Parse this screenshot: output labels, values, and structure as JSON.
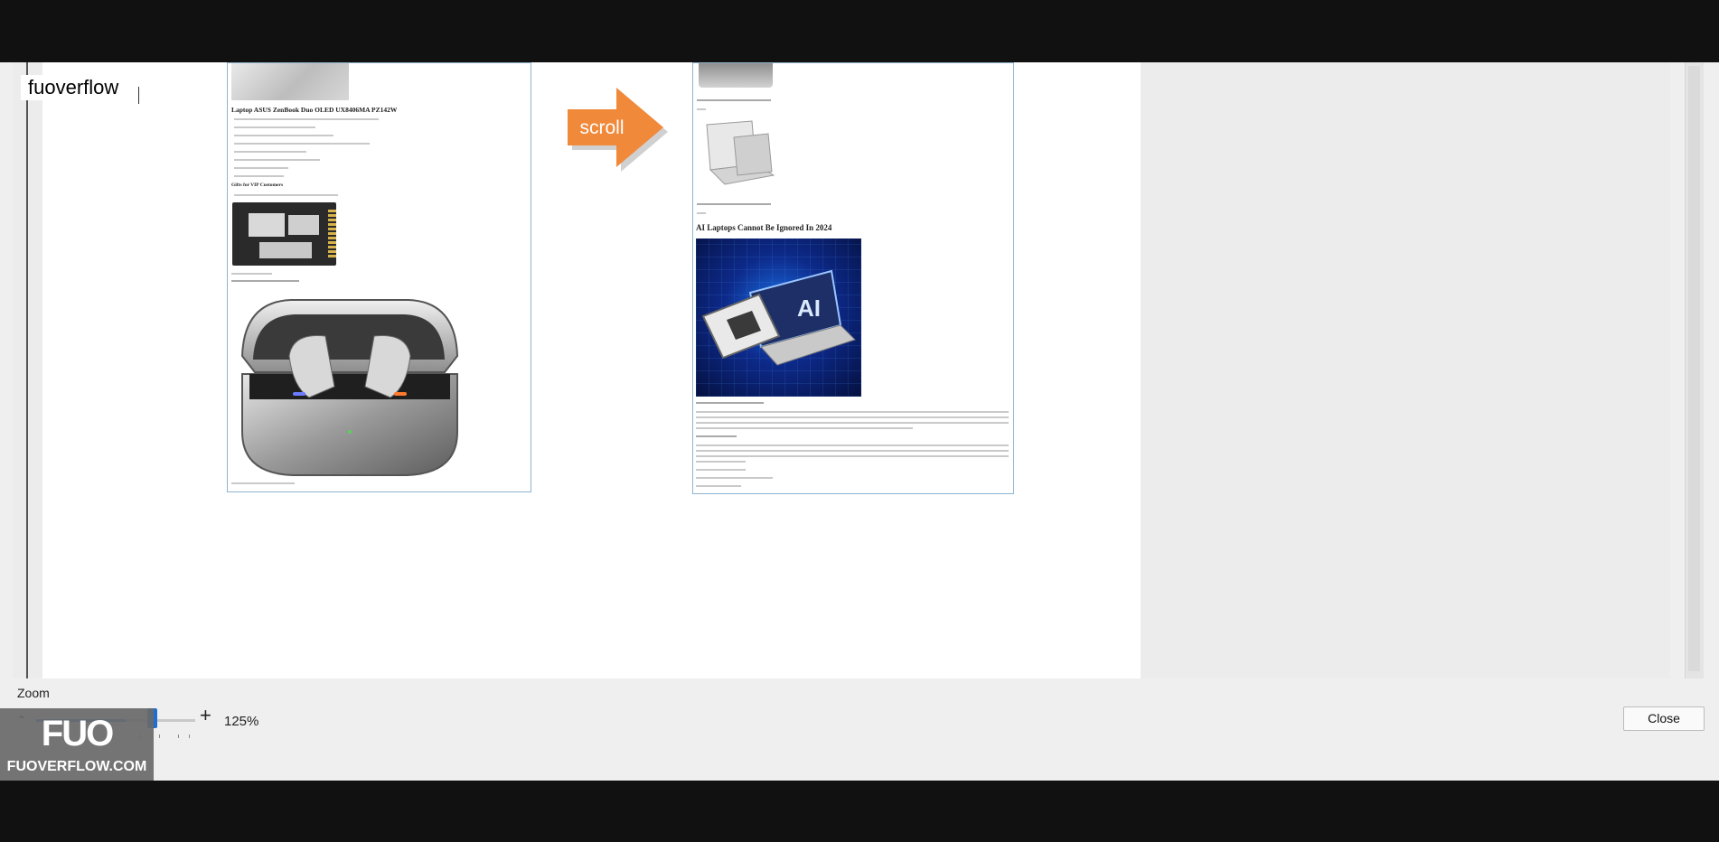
{
  "overlay": {
    "brand_label": "fuoverflow",
    "watermark_logo": "FUO",
    "watermark_text": "FUOVERFLOW.COM"
  },
  "preview": {
    "left_page": {
      "heading": "Laptop ASUS ZenBook Duo OLED UX8406MA PZ142W",
      "gift_heading": "Gifts for VIP Customers"
    },
    "right_page": {
      "heading": "AI Laptops Cannot Be Ignored In 2024"
    },
    "arrow_label": "scroll"
  },
  "zoom": {
    "label": "Zoom",
    "minus": "-",
    "plus": "+",
    "value": "125%",
    "level_fraction": 0.56
  },
  "footer": {
    "close_label": "Close"
  },
  "colors": {
    "arrow": "#f0893a",
    "slider_accent": "#1f6fcf",
    "page_border": "#8fb4cf"
  }
}
